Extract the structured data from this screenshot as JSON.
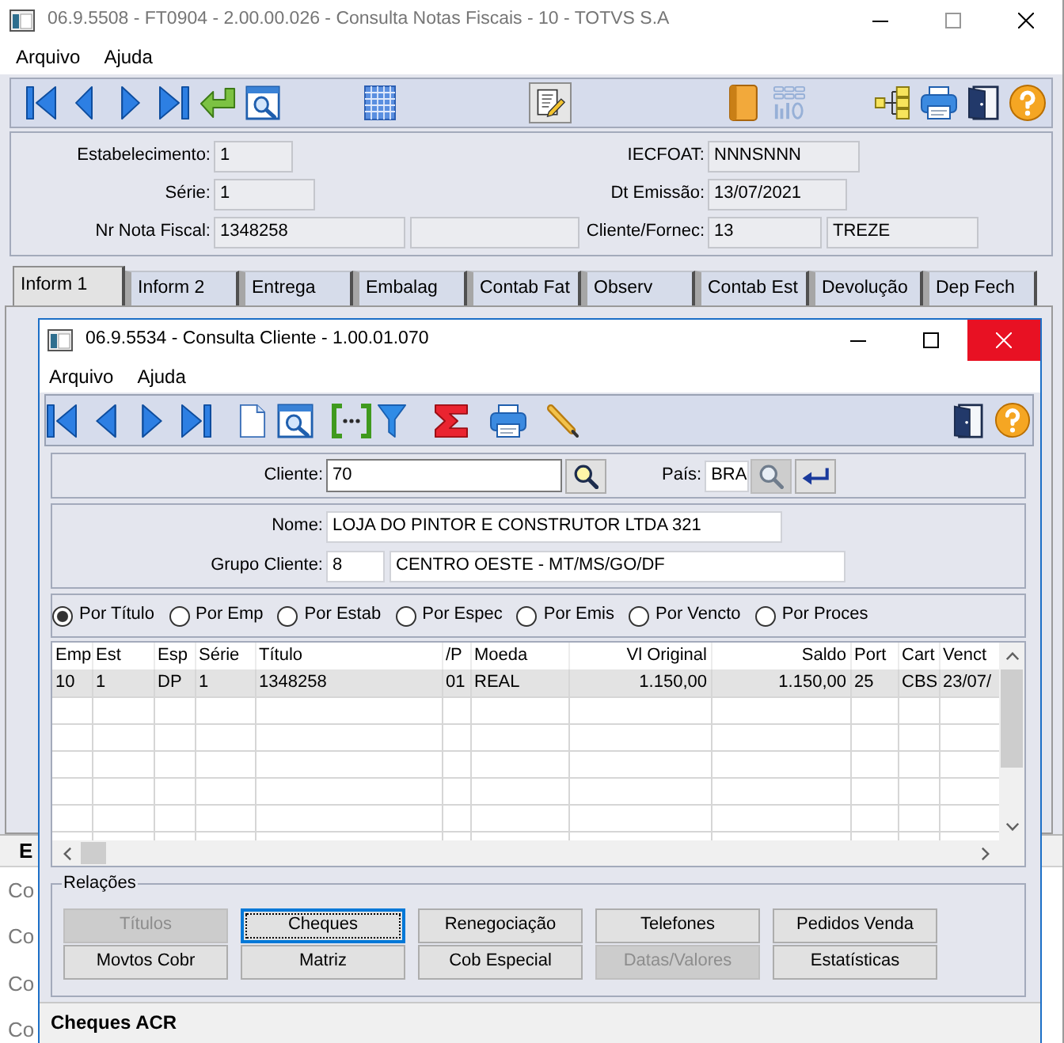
{
  "window": {
    "title": "06.9.5508 - FT0904 - 2.00.00.026 - Consulta Notas Fiscais - 10 - TOTVS S.A",
    "active": false,
    "maximize_disabled": true
  },
  "menu": [
    "Arquivo",
    "Ajuda"
  ],
  "toolbar": [
    {
      "disabled": false,
      "pressed": false
    },
    {
      "disabled": false,
      "pressed": false
    },
    {
      "disabled": false,
      "pressed": false
    },
    {
      "disabled": false,
      "pressed": false
    },
    {
      "disabled": false,
      "pressed": false
    },
    {
      "disabled": false,
      "pressed": false
    },
    {
      "disabled": false,
      "pressed": false
    },
    {
      "disabled": false,
      "pressed": true
    },
    {
      "disabled": false,
      "pressed": false
    },
    {
      "disabled": true,
      "pressed": false
    },
    {
      "disabled": false,
      "pressed": false
    },
    {
      "disabled": false,
      "pressed": false
    },
    {
      "disabled": false,
      "pressed": false
    },
    {
      "disabled": false,
      "pressed": false
    }
  ],
  "form": [
    {
      "label": "Estabelecimento:",
      "fields": [
        {
          "kind": "text",
          "value": "1"
        }
      ]
    },
    {
      "label": "IECFOAT:",
      "fields": [
        {
          "kind": "text",
          "value": "NNNSNNN"
        }
      ]
    },
    {
      "label": "Série:",
      "fields": [
        {
          "kind": "text",
          "value": "1"
        }
      ]
    },
    {
      "label": "Dt Emissão:",
      "fields": [
        {
          "kind": "text",
          "value": "13/07/2021"
        }
      ]
    },
    {
      "label": "Nr Nota Fiscal:",
      "fields": [
        {
          "kind": "text",
          "value": "1348258"
        },
        {
          "kind": "blank"
        }
      ]
    },
    {
      "label": "Cliente/Fornec:",
      "fields": [
        {
          "kind": "text",
          "value": "13"
        },
        {
          "kind": "text",
          "value": "TREZE"
        }
      ]
    }
  ],
  "tabs": [
    {
      "label": "Inform 1",
      "selected": true
    },
    {
      "label": "Inform 2",
      "selected": false
    },
    {
      "label": "Entrega",
      "selected": false
    },
    {
      "label": "Embalag",
      "selected": false
    },
    {
      "label": "Contab Fat",
      "selected": false
    },
    {
      "label": "Observ",
      "selected": false
    },
    {
      "label": "Contab Est",
      "selected": false
    },
    {
      "label": "Devolução",
      "selected": false
    },
    {
      "label": "Dep Fech",
      "selected": false
    }
  ],
  "tab_panel": {
    "header": "E",
    "list_items": [
      "Co",
      "Co",
      "Co",
      "Co"
    ]
  },
  "dialog": {
    "title": "06.9.5534 - Consulta Cliente - 1.00.01.070",
    "active": true,
    "close_hovered": true,
    "menu": [
      "Arquivo",
      "Ajuda"
    ],
    "cliente": {
      "label": "Cliente:",
      "value": "70"
    },
    "pais": {
      "label": "País:",
      "value": "BRA"
    },
    "nome": {
      "label": "Nome:",
      "value": "LOJA DO PINTOR E CONSTRUTOR LTDA 321"
    },
    "grupo_cliente": {
      "label": "Grupo Cliente:",
      "code": "8",
      "description": "CENTRO OESTE - MT/MS/GO/DF"
    },
    "sort_options": [
      {
        "label": "Por Título",
        "selected": true
      },
      {
        "label": "Por Emp",
        "selected": false
      },
      {
        "label": "Por Estab",
        "selected": false
      },
      {
        "label": "Por Espec",
        "selected": false
      },
      {
        "label": "Por Emis",
        "selected": false
      },
      {
        "label": "Por Vencto",
        "selected": false
      },
      {
        "label": "Por Proces",
        "selected": false
      }
    ],
    "table": {
      "columns": [
        {
          "label": "Emp",
          "kind": "text"
        },
        {
          "label": "Est",
          "kind": "text"
        },
        {
          "label": "Esp",
          "kind": "text"
        },
        {
          "label": "Série",
          "kind": "text"
        },
        {
          "label": "Título",
          "kind": "text"
        },
        {
          "label": "/P",
          "kind": "text"
        },
        {
          "label": "Moeda",
          "kind": "text"
        },
        {
          "label": "Vl Original",
          "kind": "amount"
        },
        {
          "label": "Saldo",
          "kind": "amount"
        },
        {
          "label": "Port",
          "kind": "text"
        },
        {
          "label": "Cart",
          "kind": "text"
        },
        {
          "label": "Venct",
          "kind": "text"
        }
      ],
      "rows": [
        {
          "selected": true,
          "cells": [
            "10",
            "1",
            "DP",
            "1",
            "1348258",
            "01",
            "REAL",
            "1.150,00",
            "1.150,00",
            "25",
            "CBS",
            "23/07/"
          ]
        }
      ]
    },
    "relations": {
      "title": "Relações",
      "buttons": [
        {
          "label": "Títulos",
          "disabled": true,
          "focused": false
        },
        {
          "label": "Cheques",
          "disabled": false,
          "focused": true
        },
        {
          "label": "Renegociação",
          "disabled": false,
          "focused": false
        },
        {
          "label": "Telefones",
          "disabled": false,
          "focused": false
        },
        {
          "label": "Pedidos Venda",
          "disabled": false,
          "focused": false
        },
        {
          "label": "Movtos Cobr",
          "disabled": false,
          "focused": false
        },
        {
          "label": "Matriz",
          "disabled": false,
          "focused": false
        },
        {
          "label": "Cob Especial",
          "disabled": false,
          "focused": false
        },
        {
          "label": "Datas/Valores",
          "disabled": true,
          "focused": false
        },
        {
          "label": "Estatísticas",
          "disabled": false,
          "focused": false
        }
      ]
    },
    "status_bar": "Cheques ACR"
  }
}
